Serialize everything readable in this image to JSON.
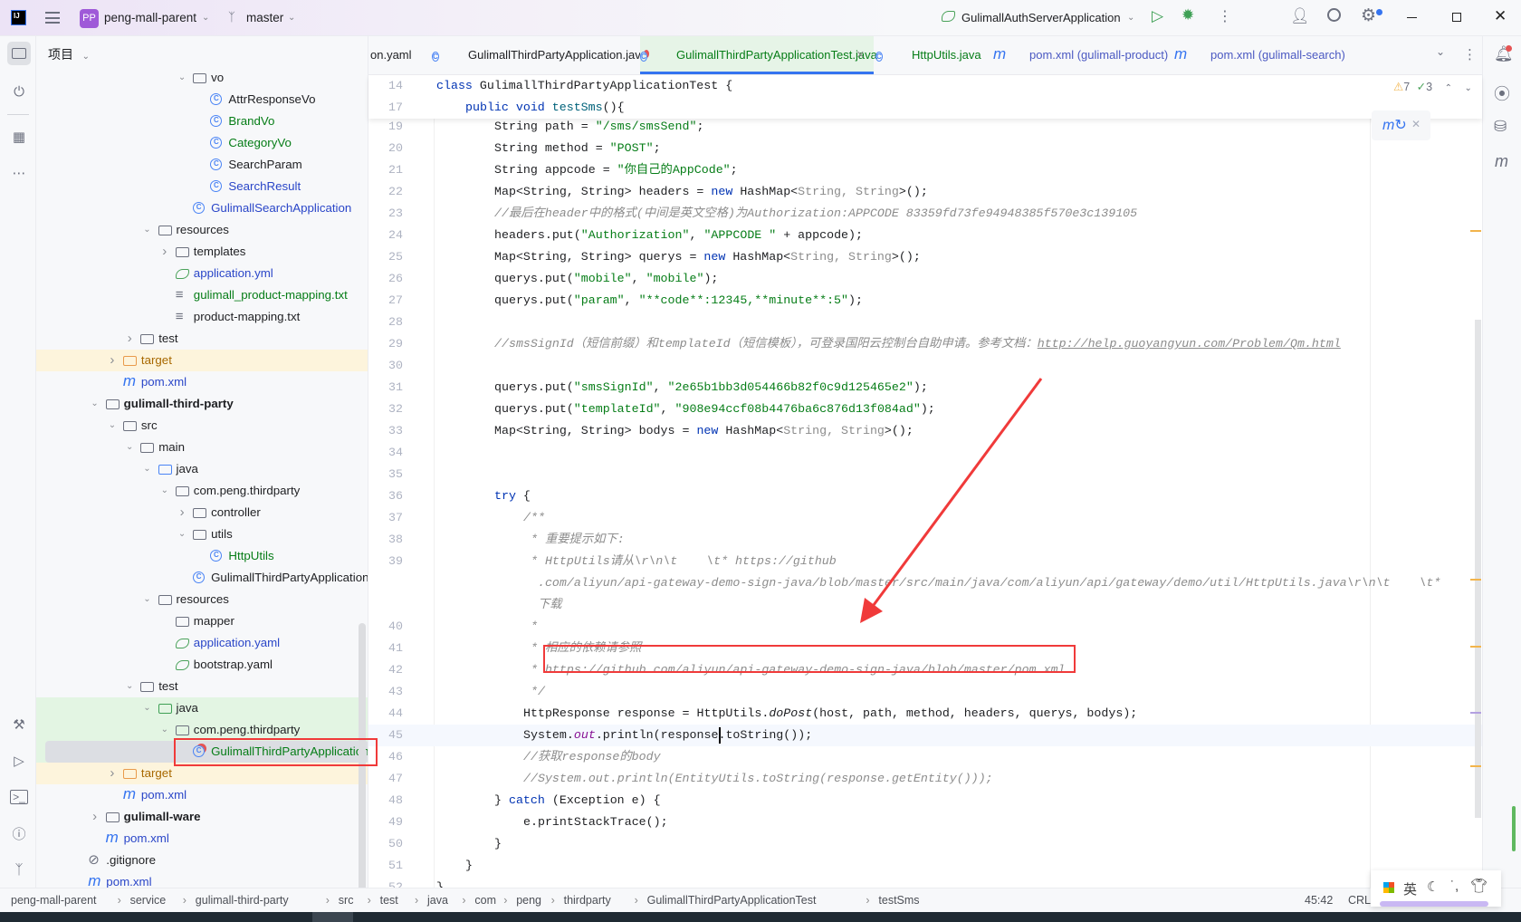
{
  "titlebar": {
    "project": "peng-mall-parent",
    "project_badge": "PP",
    "branch": "master",
    "run_config": "GulimallAuthServerApplication"
  },
  "project_panel": {
    "title": "项目"
  },
  "tree": [
    {
      "label": "vo",
      "depth": 7,
      "chev": "down",
      "icon": "package"
    },
    {
      "label": "AttrResponseVo",
      "depth": 8,
      "icon": "class",
      "color": "#1e1f22"
    },
    {
      "label": "BrandVo",
      "depth": 8,
      "icon": "class",
      "color": "#067d17"
    },
    {
      "label": "CategoryVo",
      "depth": 8,
      "icon": "class",
      "color": "#067d17"
    },
    {
      "label": "SearchParam",
      "depth": 8,
      "icon": "class",
      "color": "#1e1f22"
    },
    {
      "label": "SearchResult",
      "depth": 8,
      "icon": "class",
      "color": "#2a46c8"
    },
    {
      "label": "GulimallSearchApplication",
      "depth": 7,
      "icon": "app",
      "color": "#2a46c8"
    },
    {
      "label": "resources",
      "depth": 5,
      "chev": "down",
      "icon": "resources"
    },
    {
      "label": "templates",
      "depth": 6,
      "chev": "right",
      "icon": "folder"
    },
    {
      "label": "application.yml",
      "depth": 6,
      "icon": "spring",
      "color": "#2a46c8"
    },
    {
      "label": "gulimall_product-mapping.txt",
      "depth": 6,
      "icon": "text",
      "color": "#067d17"
    },
    {
      "label": "product-mapping.txt",
      "depth": 6,
      "icon": "text",
      "color": "#1e1f22"
    },
    {
      "label": "test",
      "depth": 4,
      "chev": "right",
      "icon": "folder"
    },
    {
      "label": "target",
      "depth": 3,
      "chev": "right",
      "icon": "folder-excluded",
      "color": "#a86800",
      "bg": "#fdf4dc"
    },
    {
      "label": "pom.xml",
      "depth": 3,
      "icon": "maven",
      "color": "#2a46c8"
    },
    {
      "label": "gulimall-third-party",
      "depth": 2,
      "chev": "down",
      "icon": "module",
      "bold": true
    },
    {
      "label": "src",
      "depth": 3,
      "chev": "down",
      "icon": "folder"
    },
    {
      "label": "main",
      "depth": 4,
      "chev": "down",
      "icon": "folder"
    },
    {
      "label": "java",
      "depth": 5,
      "chev": "down",
      "icon": "folder-source"
    },
    {
      "label": "com.peng.thirdparty",
      "depth": 6,
      "chev": "down",
      "icon": "package"
    },
    {
      "label": "controller",
      "depth": 7,
      "chev": "right",
      "icon": "package"
    },
    {
      "label": "utils",
      "depth": 7,
      "chev": "down",
      "icon": "package"
    },
    {
      "label": "HttpUtils",
      "depth": 8,
      "icon": "class",
      "color": "#067d17"
    },
    {
      "label": "GulimallThirdPartyApplication",
      "depth": 7,
      "icon": "app",
      "color": "#1e1f22"
    },
    {
      "label": "resources",
      "depth": 5,
      "chev": "down",
      "icon": "resources"
    },
    {
      "label": "mapper",
      "depth": 6,
      "icon": "folder"
    },
    {
      "label": "application.yaml",
      "depth": 6,
      "icon": "spring",
      "color": "#2a46c8"
    },
    {
      "label": "bootstrap.yaml",
      "depth": 6,
      "icon": "spring",
      "color": "#1e1f22"
    },
    {
      "label": "test",
      "depth": 4,
      "chev": "down",
      "icon": "folder"
    },
    {
      "label": "java",
      "depth": 5,
      "chev": "down",
      "icon": "folder-test",
      "bg": "#e3f5e3"
    },
    {
      "label": "com.peng.thirdparty",
      "depth": 6,
      "chev": "down",
      "icon": "package",
      "bg": "#e3f5e3"
    },
    {
      "label": "GulimallThirdPartyApplicationTe",
      "depth": 7,
      "icon": "test-class",
      "color": "#067d17",
      "bg": "#e3f5e3",
      "selected": true
    },
    {
      "label": "target",
      "depth": 3,
      "chev": "right",
      "icon": "folder-excluded",
      "color": "#a86800",
      "bg": "#fdf4dc"
    },
    {
      "label": "pom.xml",
      "depth": 3,
      "icon": "maven",
      "color": "#2a46c8"
    },
    {
      "label": "gulimall-ware",
      "depth": 2,
      "chev": "right",
      "icon": "module",
      "bold": true
    },
    {
      "label": "pom.xml",
      "depth": 2,
      "icon": "maven",
      "color": "#2a46c8"
    },
    {
      "label": ".gitignore",
      "depth": 1,
      "icon": "ignore",
      "color": "#1e1f22"
    },
    {
      "label": "pom.xml",
      "depth": 1,
      "icon": "maven",
      "color": "#2a46c8"
    }
  ],
  "tabs": [
    {
      "label": "on.yaml",
      "icon": "spring"
    },
    {
      "label": "GulimallThirdPartyApplication.java",
      "icon": "app"
    },
    {
      "label": "GulimallThirdPartyApplicationTest.java",
      "icon": "test-class",
      "active": true
    },
    {
      "label": "HttpUtils.java",
      "icon": "class"
    },
    {
      "label": "pom.xml (gulimall-product)",
      "icon": "maven"
    },
    {
      "label": "pom.xml (gulimall-search)",
      "icon": "maven"
    }
  ],
  "inspections": {
    "warnings": "7",
    "weak_warnings": "3"
  },
  "sticky": [
    {
      "n": "14",
      "indent": 0,
      "t": [
        [
          "k",
          "class "
        ],
        [
          "",
          "GulimallThirdPartyApplicationTest {"
        ]
      ]
    },
    {
      "n": "17",
      "indent": 1,
      "t": [
        [
          "k",
          "public void "
        ],
        [
          "md",
          "testSms"
        ],
        [
          "",
          "(){"
        ]
      ]
    }
  ],
  "code": [
    {
      "n": "19",
      "indent": 2,
      "t": [
        [
          "",
          "String path = "
        ],
        [
          "s",
          "\"/sms/smsSend\""
        ],
        [
          "",
          ";"
        ]
      ]
    },
    {
      "n": "20",
      "indent": 2,
      "t": [
        [
          "",
          "String method = "
        ],
        [
          "s",
          "\"POST\""
        ],
        [
          "",
          ";"
        ]
      ]
    },
    {
      "n": "21",
      "indent": 2,
      "t": [
        [
          "",
          "String appcode = "
        ],
        [
          "s",
          "\"你自己的AppCode\""
        ],
        [
          "",
          ";"
        ]
      ]
    },
    {
      "n": "22",
      "indent": 2,
      "t": [
        [
          "",
          "Map<String, String> headers = "
        ],
        [
          "k",
          "new "
        ],
        [
          "",
          "HashMap<"
        ],
        [
          "g",
          "String, String"
        ],
        [
          "",
          ">();"
        ]
      ]
    },
    {
      "n": "23",
      "indent": 2,
      "t": [
        [
          "c",
          "//最后在header中的格式(中间是英文空格)为Authorization:APPCODE 83359fd73fe94948385f570e3c139105"
        ]
      ]
    },
    {
      "n": "24",
      "indent": 2,
      "t": [
        [
          "",
          "headers.put("
        ],
        [
          "s",
          "\"Authorization\""
        ],
        [
          "",
          ", "
        ],
        [
          "s",
          "\"APPCODE \""
        ],
        [
          "",
          " + appcode);"
        ]
      ]
    },
    {
      "n": "25",
      "indent": 2,
      "t": [
        [
          "",
          "Map<String, String> querys = "
        ],
        [
          "k",
          "new "
        ],
        [
          "",
          "HashMap<"
        ],
        [
          "g",
          "String, String"
        ],
        [
          "",
          ">();"
        ]
      ]
    },
    {
      "n": "26",
      "indent": 2,
      "t": [
        [
          "",
          "querys.put("
        ],
        [
          "s",
          "\"mobile\""
        ],
        [
          "",
          ", "
        ],
        [
          "s",
          "\"mobile\""
        ],
        [
          "",
          ");"
        ]
      ]
    },
    {
      "n": "27",
      "indent": 2,
      "t": [
        [
          "",
          "querys.put("
        ],
        [
          "s",
          "\"param\""
        ],
        [
          "",
          ", "
        ],
        [
          "s",
          "\"**code**:12345,**minute**:5\""
        ],
        [
          "",
          ");"
        ]
      ]
    },
    {
      "n": "28",
      "indent": 2,
      "t": []
    },
    {
      "n": "29",
      "indent": 2,
      "t": [
        [
          "c",
          "//smsSignId（短信前缀）和templateId（短信模板），可登录国阳云控制台自助申请。参考文档："
        ],
        [
          "ln",
          "http://help.guoyangyun.com/Problem/Qm.html"
        ]
      ]
    },
    {
      "n": "30",
      "indent": 2,
      "t": []
    },
    {
      "n": "31",
      "indent": 2,
      "t": [
        [
          "",
          "querys.put("
        ],
        [
          "s",
          "\"smsSignId\""
        ],
        [
          "",
          ", "
        ],
        [
          "s",
          "\"2e65b1bb3d054466b82f0c9d125465e2\""
        ],
        [
          "",
          ");"
        ]
      ]
    },
    {
      "n": "32",
      "indent": 2,
      "t": [
        [
          "",
          "querys.put("
        ],
        [
          "s",
          "\"templateId\""
        ],
        [
          "",
          ", "
        ],
        [
          "s",
          "\"908e94ccf08b4476ba6c876d13f084ad\""
        ],
        [
          "",
          ");"
        ]
      ]
    },
    {
      "n": "33",
      "indent": 2,
      "t": [
        [
          "",
          "Map<String, String> bodys = "
        ],
        [
          "k",
          "new "
        ],
        [
          "",
          "HashMap<"
        ],
        [
          "g",
          "String, String"
        ],
        [
          "",
          ">();"
        ]
      ]
    },
    {
      "n": "34",
      "indent": 2,
      "t": []
    },
    {
      "n": "35",
      "indent": 2,
      "t": []
    },
    {
      "n": "36",
      "indent": 2,
      "t": [
        [
          "k",
          "try "
        ],
        [
          "",
          "{"
        ]
      ]
    },
    {
      "n": "37",
      "indent": 3,
      "t": [
        [
          "c",
          "/**"
        ]
      ]
    },
    {
      "n": "38",
      "indent": 3,
      "t": [
        [
          "c",
          " * 重要提示如下:"
        ]
      ]
    },
    {
      "n": "39",
      "indent": 3,
      "t": [
        [
          "c",
          " * HttpUtils请从\\r\\n\\t    \\t* https://github"
        ]
      ]
    },
    {
      "n": "",
      "indent": 3,
      "t": [
        [
          "c",
          "  .com/aliyun/api-gateway-demo-sign-java/blob/master/src/main/java/com/aliyun/api/gateway/demo/util/HttpUtils.java\\r\\n\\t    \\t*"
        ]
      ]
    },
    {
      "n": "",
      "indent": 3,
      "t": [
        [
          "c",
          "  下载"
        ]
      ]
    },
    {
      "n": "40",
      "indent": 3,
      "t": [
        [
          "c",
          " *"
        ]
      ]
    },
    {
      "n": "41",
      "indent": 3,
      "t": [
        [
          "c",
          " * 相应的依赖请参照"
        ]
      ]
    },
    {
      "n": "42",
      "indent": 3,
      "t": [
        [
          "c",
          " * https://github.com/aliyun/api-gateway-demo-sign-java/blob/master/pom.xml"
        ]
      ]
    },
    {
      "n": "43",
      "indent": 3,
      "t": [
        [
          "c",
          " */"
        ]
      ]
    },
    {
      "n": "44",
      "indent": 3,
      "t": [
        [
          "",
          "HttpResponse response = HttpUtils."
        ],
        [
          "mi",
          "doPost"
        ],
        [
          "",
          "(host, path, method, headers, querys, bodys);"
        ]
      ]
    },
    {
      "n": "45",
      "indent": 3,
      "current": true,
      "t": [
        [
          "",
          "System."
        ],
        [
          "f",
          "out"
        ],
        [
          "",
          ".println(response.toString());"
        ]
      ]
    },
    {
      "n": "46",
      "indent": 3,
      "t": [
        [
          "c",
          "//获取response的body"
        ]
      ]
    },
    {
      "n": "47",
      "indent": 3,
      "t": [
        [
          "c",
          "//System.out.println(EntityUtils.toString(response.getEntity()));"
        ]
      ]
    },
    {
      "n": "48",
      "indent": 2,
      "t": [
        [
          "",
          "} "
        ],
        [
          "k",
          "catch "
        ],
        [
          "",
          "(Exception e) {"
        ]
      ]
    },
    {
      "n": "49",
      "indent": 3,
      "t": [
        [
          "",
          "e.printStackTrace();"
        ]
      ]
    },
    {
      "n": "50",
      "indent": 2,
      "t": [
        [
          "",
          "}"
        ]
      ]
    },
    {
      "n": "51",
      "indent": 1,
      "t": [
        [
          "",
          "}"
        ]
      ]
    },
    {
      "n": "52",
      "indent": 0,
      "t": [
        [
          "",
          "}"
        ]
      ]
    }
  ],
  "breadcrumbs": [
    "peng-mall-parent",
    "service",
    "gulimall-third-party",
    "src",
    "test",
    "java",
    "com",
    "peng",
    "thirdparty",
    "GulimallThirdPartyApplicationTest",
    "testSms"
  ],
  "status": {
    "position": "45:42",
    "line_ending": "CRLF"
  },
  "ime": {
    "lang": "英"
  },
  "colors": {
    "accent": "#3574f0",
    "annotation_red": "#f03a3a",
    "active_tab_bg": "#e6f4e7"
  }
}
